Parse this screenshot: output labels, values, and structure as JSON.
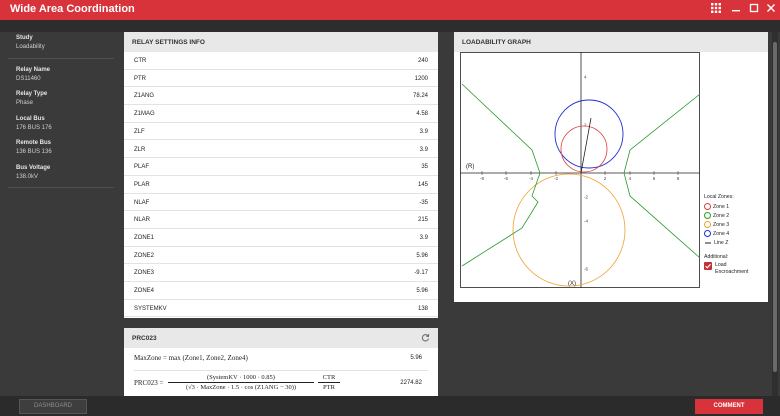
{
  "window": {
    "title": "Wide Area Coordination"
  },
  "sidebar": [
    {
      "label": "Study",
      "value": "Loadability"
    },
    {
      "label": "Relay Name",
      "value": "DS11460"
    },
    {
      "label": "Relay Type",
      "value": "Phase"
    },
    {
      "label": "Local Bus",
      "value": "176 BUS 176"
    },
    {
      "label": "Remote Bus",
      "value": "136 BUS 136"
    },
    {
      "label": "Bus Voltage",
      "value": "138.0kV"
    }
  ],
  "relay_settings": {
    "title": "RELAY SETTINGS INFO",
    "rows": [
      {
        "key": "CTR",
        "value": "240"
      },
      {
        "key": "PTR",
        "value": "1200"
      },
      {
        "key": "Z1ANG",
        "value": "78.24"
      },
      {
        "key": "Z1MAG",
        "value": "4.58"
      },
      {
        "key": "ZLF",
        "value": "3.9"
      },
      {
        "key": "ZLR",
        "value": "3.9"
      },
      {
        "key": "PLAF",
        "value": "35"
      },
      {
        "key": "PLAR",
        "value": "145"
      },
      {
        "key": "NLAF",
        "value": "-35"
      },
      {
        "key": "NLAR",
        "value": "215"
      },
      {
        "key": "ZONE1",
        "value": "3.9"
      },
      {
        "key": "ZONE2",
        "value": "5.96"
      },
      {
        "key": "ZONE3",
        "value": "-9.17"
      },
      {
        "key": "ZONE4",
        "value": "5.96"
      },
      {
        "key": "SYSTEMKV",
        "value": "138"
      }
    ]
  },
  "prc": {
    "title": "PRC023",
    "formula1": "MaxZone = max (Zone1, Zone2, Zone4)",
    "value1": "5.96",
    "formula2_lhs": "PRC023 =",
    "formula2_num": "(SystemKV · 1000 · 0.85)",
    "formula2_den": "(√3 · MaxZone · 1.5 · cos (Z1ANG − 30))",
    "formula2_ratio_num": "CTR",
    "formula2_ratio_den": "PTR",
    "value2": "2274.82"
  },
  "graph": {
    "title": "LOADABILITY GRAPH",
    "r_label": "(R)",
    "x_label": "(X)",
    "x_ticks": [
      "-8",
      "-6",
      "-4",
      "-2",
      "0",
      "2",
      "4",
      "6",
      "8"
    ],
    "y_ticks": [
      "4",
      "2",
      "0",
      "-2",
      "-4",
      "-6"
    ],
    "legend_title": "Local Zones:",
    "zones": [
      {
        "name": "Zone 1",
        "color": "#e03a3a"
      },
      {
        "name": "Zone 2",
        "color": "#2a9a2a"
      },
      {
        "name": "Zone 3",
        "color": "#f0a030"
      },
      {
        "name": "Zone 4",
        "color": "#2030d0"
      }
    ],
    "line_z_label": "Line Z",
    "additional_title": "Additional:",
    "load_encroachment_label_1": "Load",
    "load_encroachment_label_2": "Encroachment",
    "load_encroachment_checked": true
  },
  "buttons": {
    "dashboard": "DASHBOARD",
    "comment": "COMMENT"
  },
  "colors": {
    "accent": "#d8333a"
  }
}
